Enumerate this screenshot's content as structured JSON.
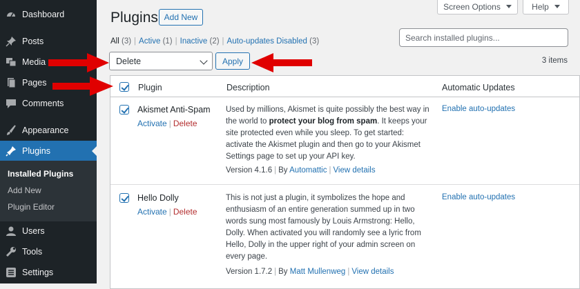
{
  "sidebar": {
    "items": [
      {
        "label": "Dashboard",
        "icon": "dashboard-icon"
      },
      {
        "label": "Posts",
        "icon": "pin-icon"
      },
      {
        "label": "Media",
        "icon": "media-icon"
      },
      {
        "label": "Pages",
        "icon": "pages-icon"
      },
      {
        "label": "Comments",
        "icon": "comment-icon"
      },
      {
        "label": "Appearance",
        "icon": "brush-icon"
      },
      {
        "label": "Plugins",
        "icon": "plugin-icon"
      },
      {
        "label": "Users",
        "icon": "user-icon"
      },
      {
        "label": "Tools",
        "icon": "wrench-icon"
      },
      {
        "label": "Settings",
        "icon": "settings-icon"
      }
    ],
    "submenu": [
      "Installed Plugins",
      "Add New",
      "Plugin Editor"
    ]
  },
  "header": {
    "screen_options": "Screen Options",
    "help": "Help",
    "title": "Plugins",
    "add_new": "Add New"
  },
  "filters": {
    "all": "All",
    "all_count": "(3)",
    "active": "Active",
    "active_count": "(1)",
    "inactive": "Inactive",
    "inactive_count": "(2)",
    "auto": "Auto-updates Disabled",
    "auto_count": "(3)",
    "separator": "|"
  },
  "search": {
    "placeholder": "Search installed plugins..."
  },
  "bulk": {
    "selected": "Delete",
    "apply": "Apply",
    "count": "3 items"
  },
  "table": {
    "columns": {
      "plugin": "Plugin",
      "description": "Description",
      "auto_updates": "Automatic Updates"
    },
    "rows": [
      {
        "name": "Akismet Anti-Spam",
        "activate": "Activate",
        "delete": "Delete",
        "desc_1": "Used by millions, Akismet is quite possibly the best way in the world to ",
        "desc_bold": "protect your blog from spam",
        "desc_2": ". It keeps your site protected even while you sleep. To get started: activate the Akismet plugin and then go to your Akismet Settings page to set up your API key.",
        "version": "Version 4.1.6",
        "by": "By",
        "author": "Automattic",
        "view": "View details",
        "auto": "Enable auto-updates"
      },
      {
        "name": "Hello Dolly",
        "activate": "Activate",
        "delete": "Delete",
        "desc": "This is not just a plugin, it symbolizes the hope and enthusiasm of an entire generation summed up in two words sung most famously by Louis Armstrong: Hello, Dolly. When activated you will randomly see a lyric from Hello, Dolly in the upper right of your admin screen on every page.",
        "version": "Version 1.7.2",
        "by": "By",
        "author": "Matt Mullenweg",
        "view": "View details",
        "auto": "Enable auto-updates"
      }
    ]
  },
  "colors": {
    "accent": "#2271b1",
    "sidebar": "#1d2327",
    "annotation_arrow": "#e00000",
    "delete": "#b32d2e"
  }
}
